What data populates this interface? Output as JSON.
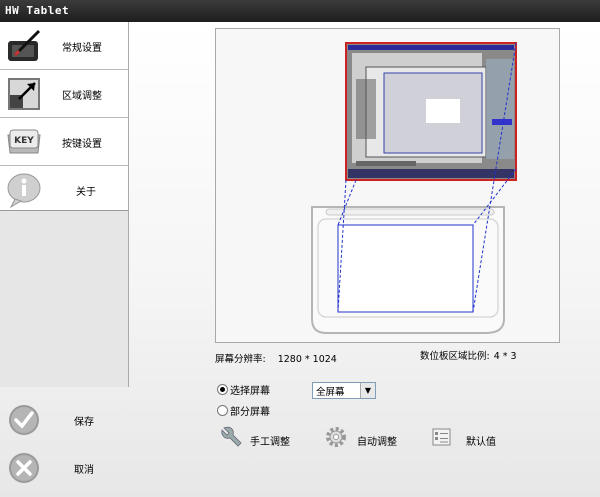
{
  "window": {
    "title": "HW Tablet"
  },
  "nav": {
    "items": [
      {
        "label": "常规设置",
        "icon": "tablet-pen-icon"
      },
      {
        "label": "区域调整",
        "icon": "area-arrow-icon"
      },
      {
        "label": "按键设置",
        "icon": "key-icon"
      },
      {
        "label": "关于",
        "icon": "info-icon"
      }
    ]
  },
  "actions": {
    "save_label": "保存",
    "cancel_label": "取消"
  },
  "info": {
    "resolution_label": "屏幕分辨率:",
    "resolution_value": "1280 * 1024",
    "ratio_label": "数位板区域比例:",
    "ratio_value": "4 * 3"
  },
  "screen_mode": {
    "option_select": "选择屏幕",
    "option_partial": "部分屏幕",
    "selected": "选择屏幕",
    "dropdown_value": "全屏幕"
  },
  "tools": {
    "manual_label": "手工调整",
    "auto_label": "自动调整",
    "default_label": "默认值"
  },
  "colors": {
    "title_bar": "#2a2a2a",
    "mapping_line": "#2233cc",
    "screen_border": "#cc2222"
  }
}
